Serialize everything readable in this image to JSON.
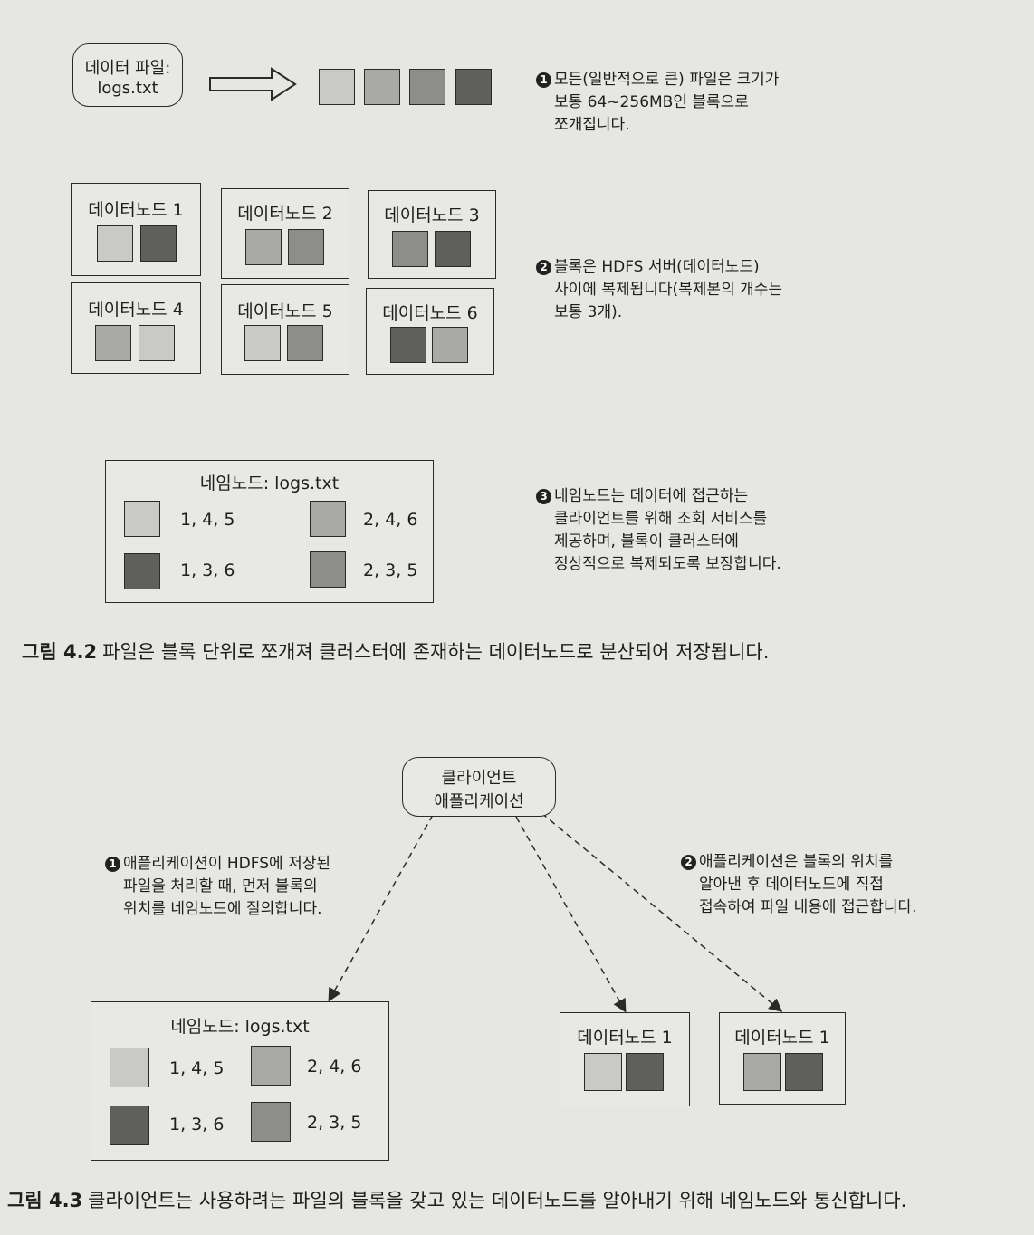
{
  "colors": {
    "block1": "#c9c9c6",
    "block2": "#a9a9a6",
    "block3": "#8d8d8a",
    "block4": "#5f5f5c",
    "line": "#2a2a2a"
  },
  "figure1": {
    "file_label_line1": "데이터 파일:",
    "file_label_line2": "logs.txt",
    "note1": {
      "num": "1",
      "lines": [
        "모든(일반적으로 큰) 파일은 크기가",
        "보통 64~256MB인 블록으로",
        "쪼개집니다."
      ]
    },
    "datanodes": [
      {
        "label": "데이터노드 1"
      },
      {
        "label": "데이터노드 2"
      },
      {
        "label": "데이터노드 3"
      },
      {
        "label": "데이터노드 4"
      },
      {
        "label": "데이터노드 5"
      },
      {
        "label": "데이터노드 6"
      }
    ],
    "note2": {
      "num": "2",
      "lines": [
        "블록은 HDFS 서버(데이터노드)",
        "사이에 복제됩니다(복제본의 개수는",
        "보통 3개)."
      ]
    },
    "namenode": {
      "title": "네임노드: logs.txt",
      "entries": [
        "1, 4, 5",
        "2, 4, 6",
        "1, 3, 6",
        "2, 3, 5"
      ]
    },
    "note3": {
      "num": "3",
      "lines": [
        "네임노드는 데이터에 접근하는",
        "클라이언트를 위해 조회 서비스를",
        "제공하며, 블록이 클러스터에",
        "정상적으로 복제되도록 보장합니다."
      ]
    },
    "caption_fig": "그림 4.2",
    "caption_text": "파일은 블록 단위로 쪼개져 클러스터에 존재하는 데이터노드로 분산되어 저장됩니다."
  },
  "figure2": {
    "client_line1": "클라이언트",
    "client_line2": "애플리케이션",
    "note1": {
      "num": "1",
      "lines": [
        "애플리케이션이 HDFS에 저장된",
        "파일을 처리할 때, 먼저 블록의",
        "위치를 네임노드에 질의합니다."
      ]
    },
    "note2": {
      "num": "2",
      "lines": [
        "애플리케이션은 블록의 위치를",
        "알아낸 후 데이터노드에 직접",
        "접속하여 파일 내용에 접근합니다."
      ]
    },
    "namenode": {
      "title": "네임노드: logs.txt",
      "entries": [
        "1, 4, 5",
        "2, 4, 6",
        "1, 3, 6",
        "2, 3, 5"
      ]
    },
    "datanodes": [
      {
        "label": "데이터노드 1"
      },
      {
        "label": "데이터노드 1"
      }
    ],
    "caption_fig": "그림 4.3",
    "caption_text": "클라이언트는 사용하려는 파일의 블록을 갖고 있는 데이터노드를 알아내기 위해 네임노드와 통신합니다."
  }
}
